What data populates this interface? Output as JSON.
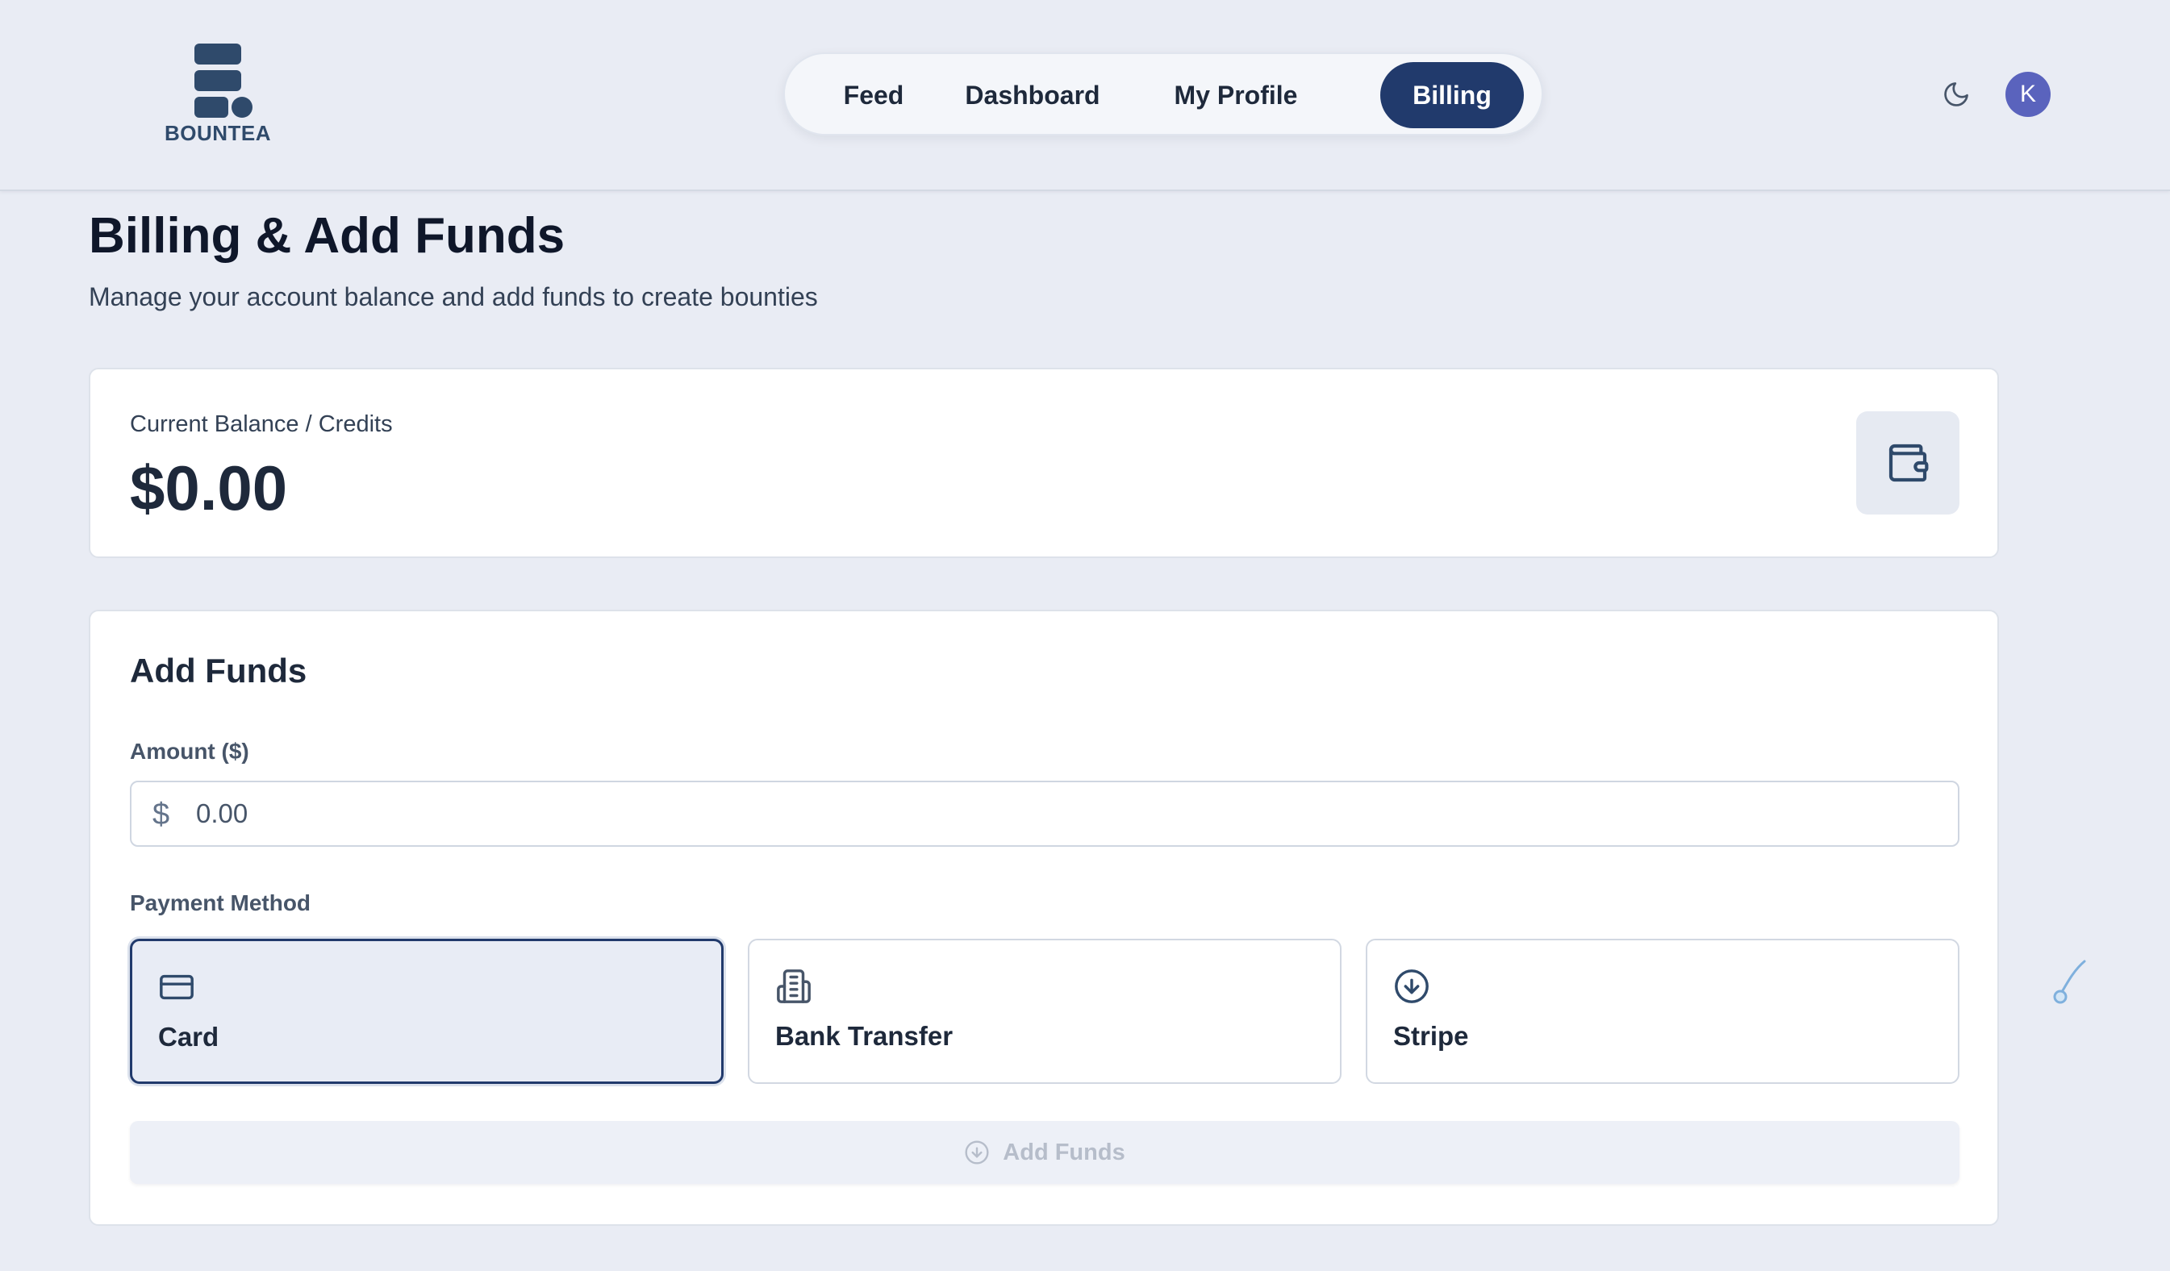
{
  "header": {
    "logo_text": "BOUNTEA",
    "brand_color": "#2f4a6b",
    "nav": [
      {
        "label": "Feed",
        "active": false
      },
      {
        "label": "Dashboard",
        "active": false
      },
      {
        "label": "My Profile",
        "active": false
      },
      {
        "label": "Billing",
        "active": true
      }
    ],
    "nav_active_color": "#213a6c",
    "theme_toggle_icon": "moon-icon",
    "avatar_initial": "K",
    "avatar_color": "#5a63bd"
  },
  "page": {
    "title": "Billing & Add Funds",
    "subtitle": "Manage your account balance and add funds to create bounties"
  },
  "balance": {
    "label": "Current Balance / Credits",
    "value": "$0.00",
    "icon": "wallet-icon"
  },
  "add_funds": {
    "title": "Add Funds",
    "amount_label": "Amount ($)",
    "currency_symbol": "$",
    "amount_placeholder": "0.00",
    "amount_value": "",
    "payment_method_label": "Payment Method",
    "methods": [
      {
        "label": "Card",
        "icon": "credit-card-icon",
        "selected": true
      },
      {
        "label": "Bank Transfer",
        "icon": "bank-building-icon",
        "selected": false
      },
      {
        "label": "Stripe",
        "icon": "arrow-down-circle-icon",
        "selected": false
      }
    ],
    "submit_label": "Add Funds",
    "submit_icon": "plus-circle-icon",
    "submit_disabled": true
  }
}
